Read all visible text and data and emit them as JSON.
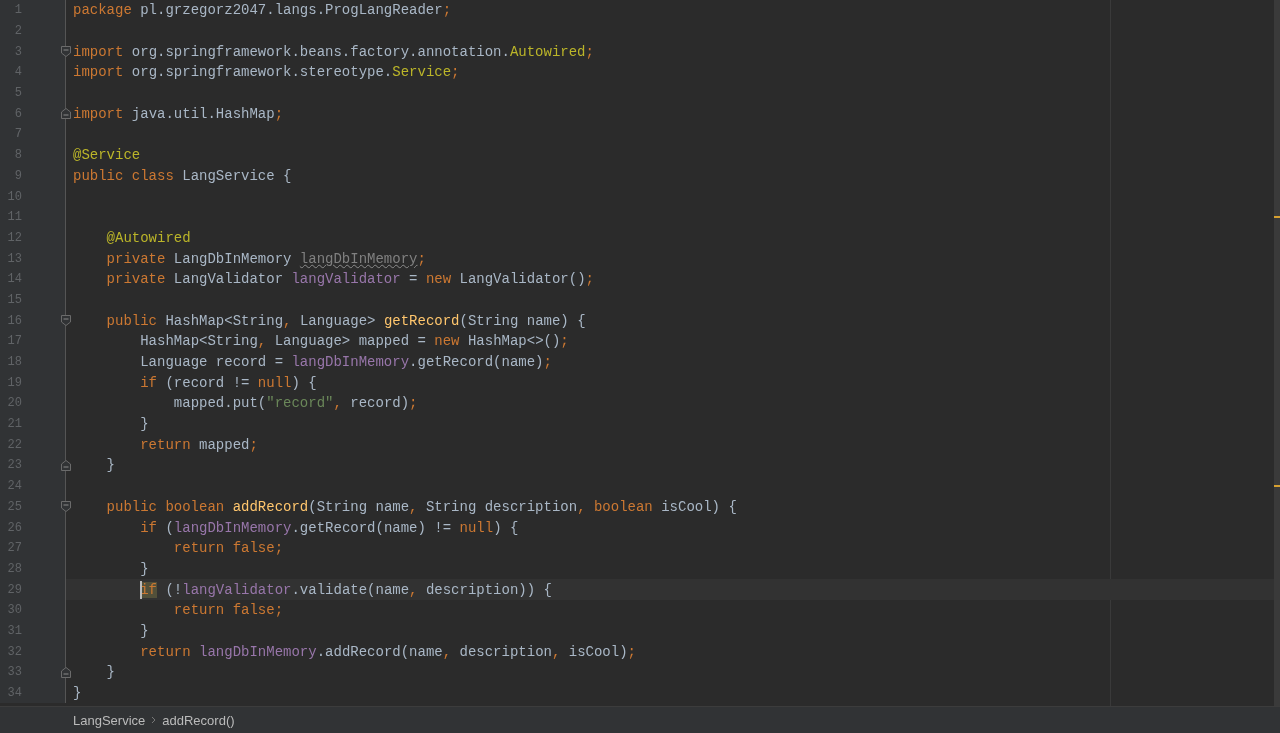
{
  "editor": {
    "lines": [
      {
        "number": "1",
        "tokens": [
          {
            "text": "package",
            "kind": "keyword"
          },
          {
            "text": " pl.grzegorz2047.langs.ProgLangReader",
            "kind": "plain"
          },
          {
            "text": ";",
            "kind": "punct"
          }
        ]
      },
      {
        "number": "2"
      },
      {
        "number": "3",
        "fold_start": true,
        "tokens": [
          {
            "text": "import",
            "kind": "keyword"
          },
          {
            "text": " org.springframework.beans.factory.annotation.",
            "kind": "plain"
          },
          {
            "text": "Autowired",
            "kind": "annotation"
          },
          {
            "text": ";",
            "kind": "punct"
          }
        ]
      },
      {
        "number": "4",
        "tokens": [
          {
            "text": "import",
            "kind": "keyword"
          },
          {
            "text": " org.springframework.stereotype.",
            "kind": "plain"
          },
          {
            "text": "Service",
            "kind": "annotation"
          },
          {
            "text": ";",
            "kind": "punct"
          }
        ]
      },
      {
        "number": "5"
      },
      {
        "number": "6",
        "fold_end": true,
        "tokens": [
          {
            "text": "import",
            "kind": "keyword"
          },
          {
            "text": " java.util.HashMap",
            "kind": "plain"
          },
          {
            "text": ";",
            "kind": "punct"
          }
        ]
      },
      {
        "number": "7"
      },
      {
        "number": "8",
        "tokens": [
          {
            "text": "@Service",
            "kind": "annotation"
          }
        ]
      },
      {
        "number": "9",
        "tokens": [
          {
            "text": "public class",
            "kind": "keyword"
          },
          {
            "text": " LangService {",
            "kind": "plain"
          }
        ]
      },
      {
        "number": "10"
      },
      {
        "number": "11",
        "stripe_mark": true
      },
      {
        "number": "12",
        "tokens": [
          {
            "text": "    @Autowired",
            "kind": "annotation"
          }
        ]
      },
      {
        "number": "13",
        "tokens": [
          {
            "text": "    private",
            "kind": "keyword"
          },
          {
            "text": " LangDbInMemory",
            "kind": "plain"
          },
          {
            "text": " langDbInMemory",
            "kind": "unused"
          },
          {
            "text": ";",
            "kind": "punct"
          }
        ]
      },
      {
        "number": "14",
        "tokens": [
          {
            "text": "    private",
            "kind": "keyword"
          },
          {
            "text": " LangValidator",
            "kind": "plain"
          },
          {
            "text": " langValidator",
            "kind": "field"
          },
          {
            "text": " =",
            "kind": "plain"
          },
          {
            "text": " new",
            "kind": "keyword"
          },
          {
            "text": " LangValidator()",
            "kind": "plain"
          },
          {
            "text": ";",
            "kind": "punct"
          }
        ]
      },
      {
        "number": "15"
      },
      {
        "number": "16",
        "fold_start": true,
        "tokens": [
          {
            "text": "    public",
            "kind": "keyword"
          },
          {
            "text": " HashMap<String",
            "kind": "plain"
          },
          {
            "text": ",",
            "kind": "punct"
          },
          {
            "text": " Language>",
            "kind": "plain"
          },
          {
            "text": " getRecord",
            "kind": "method"
          },
          {
            "text": "(String name) {",
            "kind": "plain"
          }
        ]
      },
      {
        "number": "17",
        "tokens": [
          {
            "text": "        HashMap<String",
            "kind": "plain"
          },
          {
            "text": ",",
            "kind": "punct"
          },
          {
            "text": " Language> mapped =",
            "kind": "plain"
          },
          {
            "text": " new",
            "kind": "keyword"
          },
          {
            "text": " HashMap<>()",
            "kind": "plain"
          },
          {
            "text": ";",
            "kind": "punct"
          }
        ]
      },
      {
        "number": "18",
        "tokens": [
          {
            "text": "        Language record =",
            "kind": "plain"
          },
          {
            "text": " langDbInMemory",
            "kind": "field"
          },
          {
            "text": ".getRecord(name)",
            "kind": "plain"
          },
          {
            "text": ";",
            "kind": "punct"
          }
        ]
      },
      {
        "number": "19",
        "tokens": [
          {
            "text": "        if",
            "kind": "keyword"
          },
          {
            "text": " (record !=",
            "kind": "plain"
          },
          {
            "text": " null",
            "kind": "keyword"
          },
          {
            "text": ") {",
            "kind": "plain"
          }
        ]
      },
      {
        "number": "20",
        "tokens": [
          {
            "text": "            mapped.put(",
            "kind": "plain"
          },
          {
            "text": "\"record\"",
            "kind": "string"
          },
          {
            "text": ",",
            "kind": "punct"
          },
          {
            "text": " record)",
            "kind": "plain"
          },
          {
            "text": ";",
            "kind": "punct"
          }
        ]
      },
      {
        "number": "21",
        "tokens": [
          {
            "text": "        }",
            "kind": "plain"
          }
        ]
      },
      {
        "number": "22",
        "tokens": [
          {
            "text": "        return",
            "kind": "keyword"
          },
          {
            "text": " mapped",
            "kind": "plain"
          },
          {
            "text": ";",
            "kind": "punct"
          }
        ]
      },
      {
        "number": "23",
        "fold_end": true,
        "tokens": [
          {
            "text": "    }",
            "kind": "plain"
          }
        ]
      },
      {
        "number": "24",
        "stripe_mark": true
      },
      {
        "number": "25",
        "fold_start": true,
        "tokens": [
          {
            "text": "    public boolean",
            "kind": "keyword"
          },
          {
            "text": " addRecord",
            "kind": "method"
          },
          {
            "text": "(String name",
            "kind": "plain"
          },
          {
            "text": ",",
            "kind": "punct"
          },
          {
            "text": " String description",
            "kind": "plain"
          },
          {
            "text": ",",
            "kind": "punct"
          },
          {
            "text": " boolean",
            "kind": "keyword"
          },
          {
            "text": " isCool) {",
            "kind": "plain"
          }
        ]
      },
      {
        "number": "26",
        "tokens": [
          {
            "text": "        if",
            "kind": "keyword"
          },
          {
            "text": " (",
            "kind": "plain"
          },
          {
            "text": "langDbInMemory",
            "kind": "field"
          },
          {
            "text": ".getRecord(name) !=",
            "kind": "plain"
          },
          {
            "text": " null",
            "kind": "keyword"
          },
          {
            "text": ") {",
            "kind": "plain"
          }
        ]
      },
      {
        "number": "27",
        "tokens": [
          {
            "text": "            return false",
            "kind": "keyword"
          },
          {
            "text": ";",
            "kind": "punct"
          }
        ]
      },
      {
        "number": "28",
        "tokens": [
          {
            "text": "        }",
            "kind": "plain"
          }
        ]
      },
      {
        "number": "29",
        "current": true,
        "tokens": [
          {
            "text": "        if",
            "kind": "keyword",
            "highlighted": true,
            "caret": true
          },
          {
            "text": " (!",
            "kind": "plain"
          },
          {
            "text": "langValidator",
            "kind": "field"
          },
          {
            "text": ".validate(name",
            "kind": "plain"
          },
          {
            "text": ",",
            "kind": "punct"
          },
          {
            "text": " description)) {",
            "kind": "plain"
          }
        ]
      },
      {
        "number": "30",
        "tokens": [
          {
            "text": "            return false",
            "kind": "keyword"
          },
          {
            "text": ";",
            "kind": "punct"
          }
        ]
      },
      {
        "number": "31",
        "tokens": [
          {
            "text": "        }",
            "kind": "plain"
          }
        ]
      },
      {
        "number": "32",
        "tokens": [
          {
            "text": "        return",
            "kind": "keyword"
          },
          {
            "text": " langDbInMemory",
            "kind": "field"
          },
          {
            "text": ".addRecord(name",
            "kind": "plain"
          },
          {
            "text": ",",
            "kind": "punct"
          },
          {
            "text": " description",
            "kind": "plain"
          },
          {
            "text": ",",
            "kind": "punct"
          },
          {
            "text": " isCool)",
            "kind": "plain"
          },
          {
            "text": ";",
            "kind": "punct"
          }
        ]
      },
      {
        "number": "33",
        "fold_end": true,
        "tokens": [
          {
            "text": "    }",
            "kind": "plain"
          }
        ]
      },
      {
        "number": "34",
        "tokens": [
          {
            "text": "}",
            "kind": "plain"
          }
        ]
      }
    ]
  },
  "breadcrumbs": [
    "LangService",
    "addRecord()"
  ]
}
